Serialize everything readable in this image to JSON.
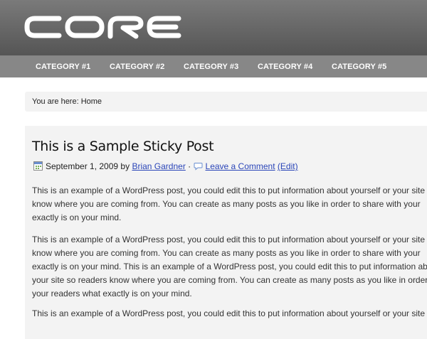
{
  "header": {
    "logo_text": "CORE"
  },
  "nav": {
    "items": [
      "CATEGORY #1",
      "CATEGORY #2",
      "CATEGORY #3",
      "CATEGORY #4",
      "CATEGORY #5"
    ]
  },
  "breadcrumb": "You are here: Home",
  "post": {
    "title": "This is a Sample Sticky Post",
    "date": "September 1, 2009",
    "by": "by",
    "author": "Brian Gardner",
    "sep": "·",
    "comment_link": "Leave a Comment",
    "edit_link": "(Edit)",
    "paragraphs": [
      [
        "This is an example of a WordPress post, you could edit this to put information about yourself or your site",
        "know where you are coming from. You can create as many posts as you like in order to share with your",
        "exactly is on your mind."
      ],
      [
        "This is an example of a WordPress post, you could edit this to put information about yourself or your site",
        "know where you are coming from. You can create as many posts as you like in order to share with your",
        "exactly is on your mind. This is an example of a WordPress post, you could edit this to put information about",
        "your site so readers know where you are coming from. You can create as many posts as you like in order",
        "your readers what exactly is on your mind."
      ],
      [
        "This is an example of a WordPress post, you could edit this to put information about yourself or your site"
      ]
    ]
  }
}
